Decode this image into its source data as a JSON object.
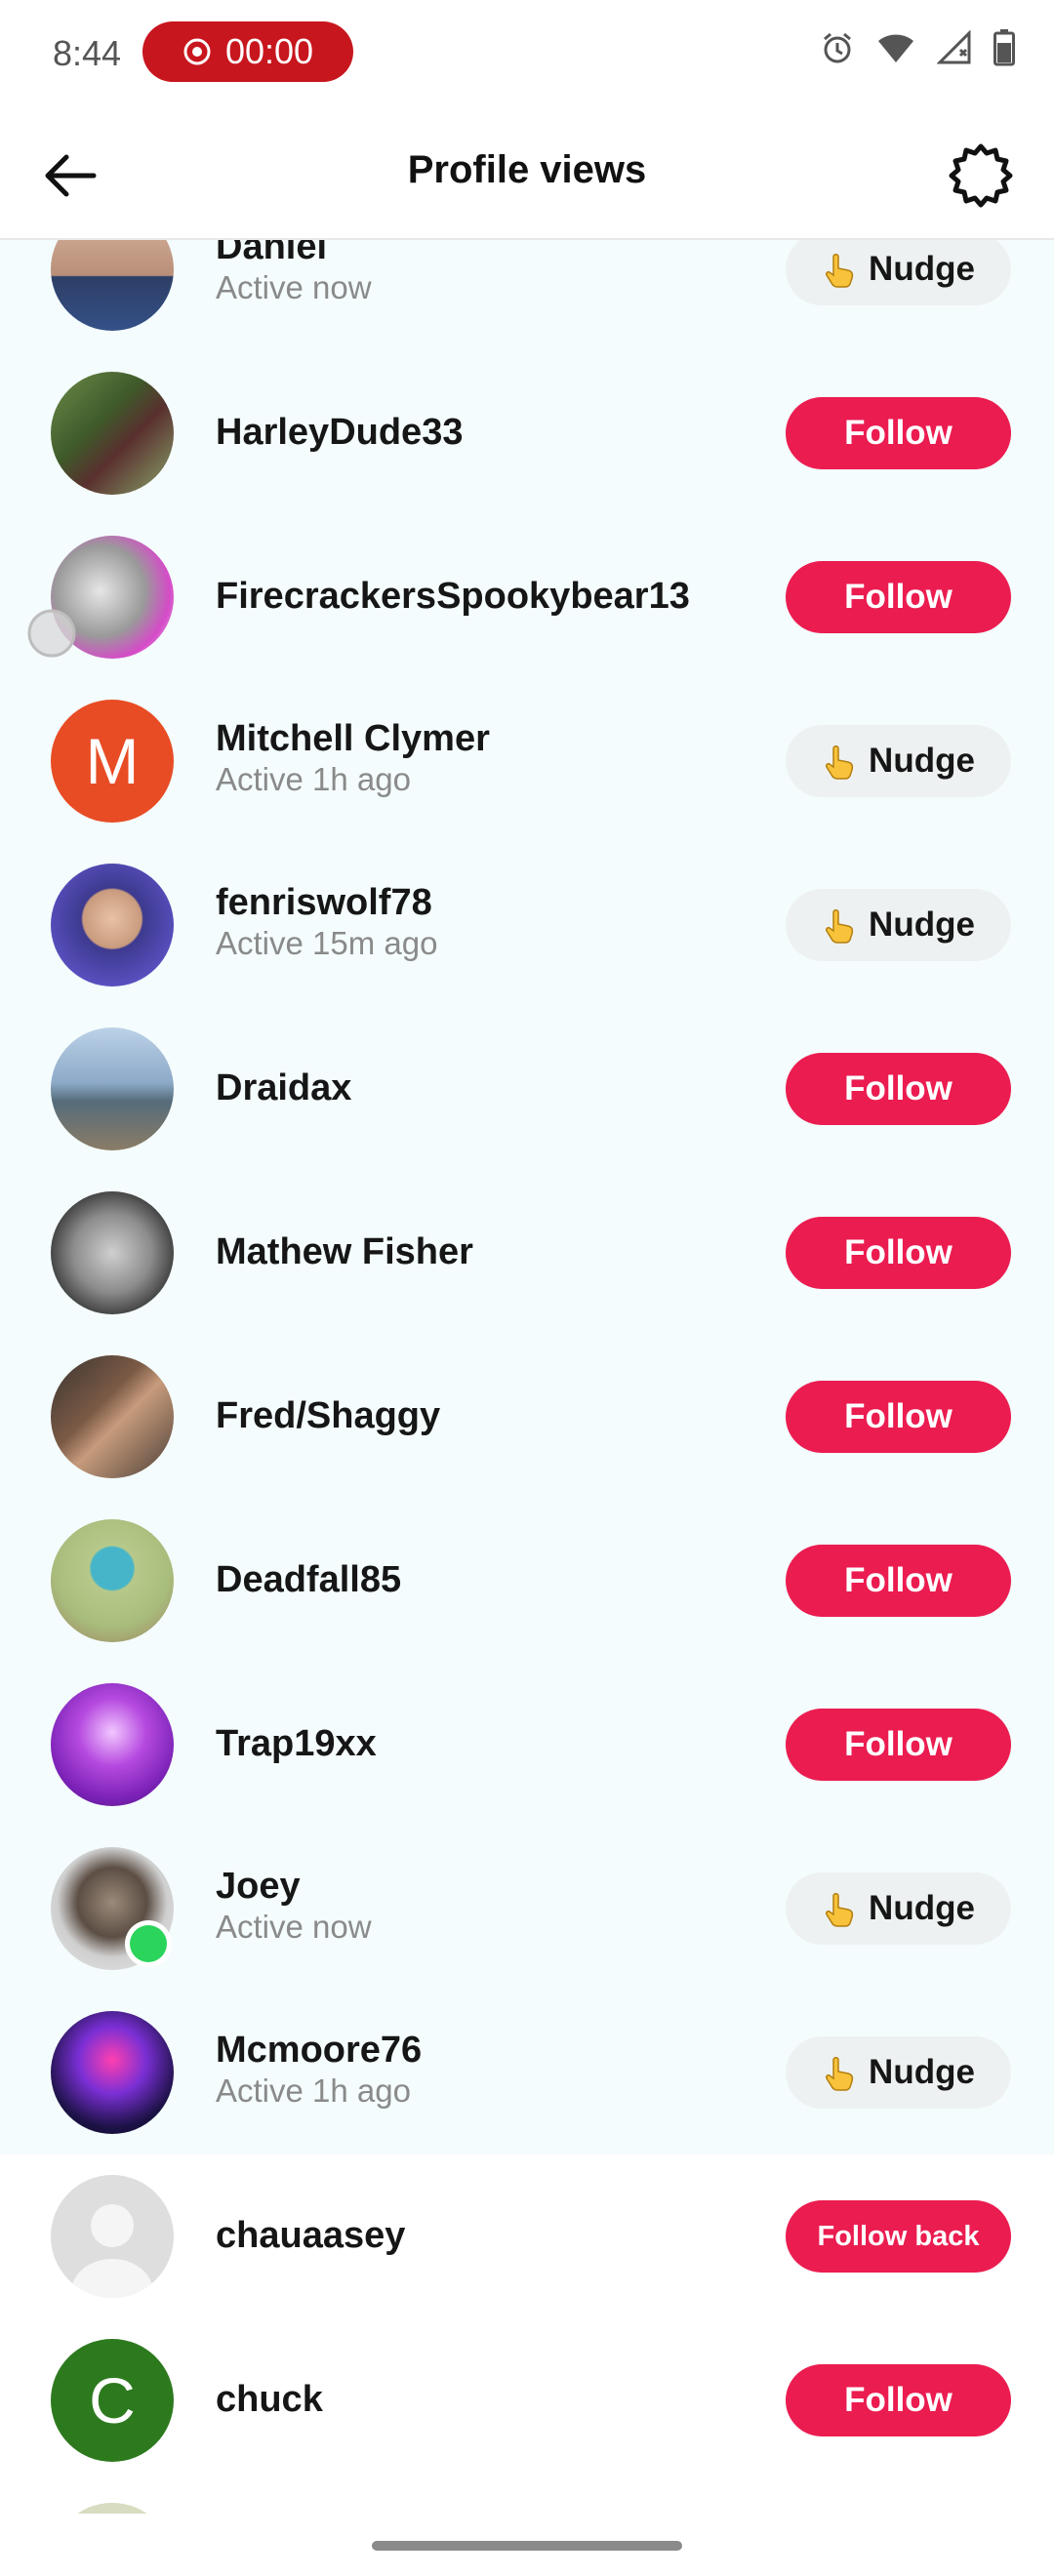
{
  "status_bar": {
    "time": "8:44",
    "recording_timer": "00:00",
    "icons": [
      "alarm-icon",
      "wifi-icon",
      "signal-icon",
      "battery-icon"
    ]
  },
  "header": {
    "title": "Profile views",
    "back_icon": "arrow-left-icon",
    "settings_icon": "gear-icon"
  },
  "colors": {
    "follow_button": "#eb1c50",
    "nudge_button": "#eef1f1",
    "highlight_row": "#f4fcfd",
    "recording_pill": "#c8161e",
    "online_dot": "#2bd45a"
  },
  "viewers": [
    {
      "name": "Daniel",
      "status": "Active now",
      "action": "Nudge",
      "nudge_icon": "👆"
    },
    {
      "name": "HarleyDude33",
      "status": "",
      "action": "Follow"
    },
    {
      "name": "FirecrackersSpookybear13",
      "status": "",
      "action": "Follow"
    },
    {
      "name": "Mitchell Clymer",
      "status": "Active 1h ago",
      "action": "Nudge",
      "nudge_icon": "👆",
      "avatar_letter": "M"
    },
    {
      "name": "fenriswolf78",
      "status": "Active 15m ago",
      "action": "Nudge",
      "nudge_icon": "👆"
    },
    {
      "name": "Draidax",
      "status": "",
      "action": "Follow"
    },
    {
      "name": "Mathew Fisher",
      "status": "",
      "action": "Follow"
    },
    {
      "name": "Fred/Shaggy",
      "status": "",
      "action": "Follow"
    },
    {
      "name": "Deadfall85",
      "status": "",
      "action": "Follow"
    },
    {
      "name": "Trap19xx",
      "status": "",
      "action": "Follow"
    },
    {
      "name": "Joey",
      "status": "Active now",
      "action": "Nudge",
      "nudge_icon": "👆"
    },
    {
      "name": "Mcmoore76",
      "status": "Active 1h ago",
      "action": "Nudge",
      "nudge_icon": "👆"
    },
    {
      "name": "chauaasey",
      "status": "",
      "action": "Follow back"
    },
    {
      "name": "chuck",
      "status": "",
      "action": "Follow",
      "avatar_letter": "C"
    }
  ]
}
